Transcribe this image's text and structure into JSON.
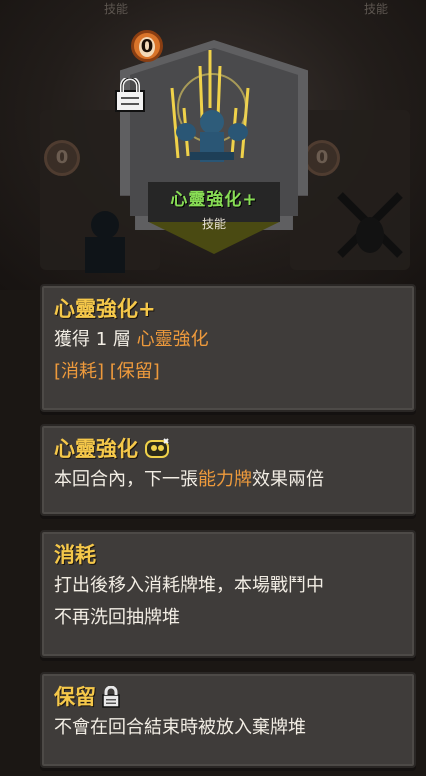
{
  "top_tabs": [
    "技能",
    "技能"
  ],
  "background": {
    "ghost_costs": [
      "0",
      "0"
    ]
  },
  "card": {
    "cost": "0",
    "name": "心靈強化+",
    "type": "技能",
    "lock_icon": "padlock-icon",
    "art_icon": "meditating-figure-icon"
  },
  "panels": {
    "main": {
      "title": "心靈強化+",
      "desc_prefix": "獲得 1 層",
      "desc_highlight": "心靈強化",
      "keywords": "[消耗] [保留]"
    },
    "buff": {
      "title": "心靈強化",
      "icon": "brain-spark-icon",
      "desc_prefix": "本回合內，下一張",
      "desc_highlight": "能力牌",
      "desc_suffix": "效果兩倍"
    },
    "exhaust": {
      "title": "消耗",
      "desc_line1": "打出後移入消耗牌堆，本場戰鬥中",
      "desc_line2": "不再洗回抽牌堆"
    },
    "retain": {
      "title": "保留",
      "icon": "padlock-icon",
      "desc": "不會在回合結束時被放入棄牌堆"
    }
  },
  "colors": {
    "title_gold": "#f5c84a",
    "card_name_green": "#88dd55",
    "highlight_orange": "#ee9a3c",
    "cost_orange": "#d9742a"
  }
}
